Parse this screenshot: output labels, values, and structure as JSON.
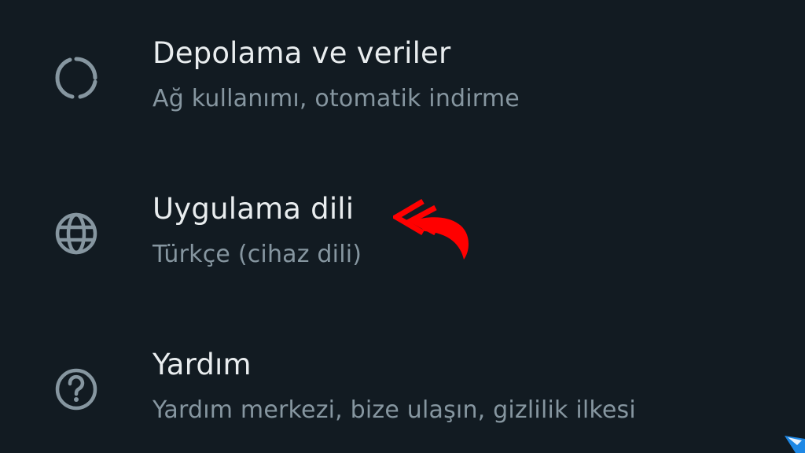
{
  "colors": {
    "background": "#121b22",
    "primary_text": "#e9edef",
    "secondary_text": "#8696a0",
    "icon": "#8696a0",
    "annotation": "#ff0000",
    "corner_logo": "#1e88e5"
  },
  "settings": {
    "items": [
      {
        "icon": "data-usage-icon",
        "title": "Depolama ve veriler",
        "subtitle": "Ağ kullanımı, otomatik indirme"
      },
      {
        "icon": "globe-icon",
        "title": "Uygulama dili",
        "subtitle": "Türkçe (cihaz dili)"
      },
      {
        "icon": "help-circle-icon",
        "title": "Yardım",
        "subtitle": "Yardım merkezi, bize ulaşın, gizlilik ilkesi"
      }
    ]
  },
  "annotation": {
    "icon": "curved-arrow-pointer-icon"
  },
  "watermark": {
    "icon": "corner-logo-icon"
  }
}
